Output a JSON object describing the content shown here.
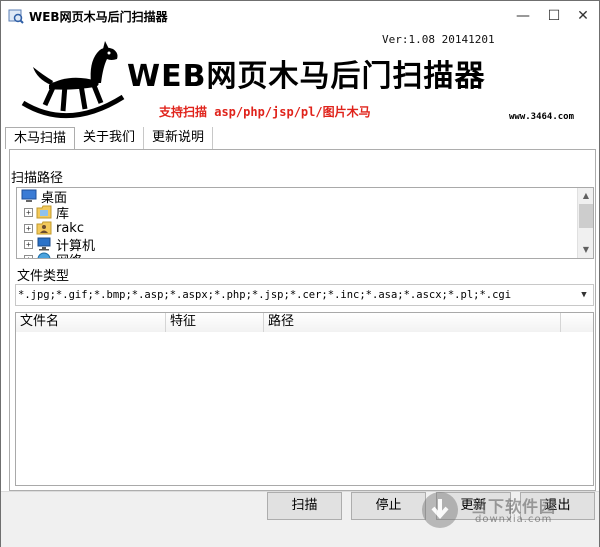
{
  "window": {
    "title": "WEB网页木马后门扫描器",
    "minimize": "—",
    "maximize": "☐",
    "close": "✕"
  },
  "banner": {
    "version": "Ver:1.08 20141201",
    "title": "WEB网页木马后门扫描器",
    "support": "支持扫描 asp/php/jsp/pl/图片木马",
    "site": "www.3464.com",
    "support_color": "#e0231b"
  },
  "tabs": [
    {
      "label": "木马扫描",
      "active": true
    },
    {
      "label": "关于我们",
      "active": false
    },
    {
      "label": "更新说明",
      "active": false
    }
  ],
  "scan_path": {
    "label": "扫描路径",
    "tree": [
      {
        "label": "桌面",
        "icon": "desktop-icon",
        "expander": ""
      },
      {
        "label": "库",
        "icon": "library-folder-icon",
        "expander": "+"
      },
      {
        "label": "rakc",
        "icon": "user-folder-icon",
        "expander": "+"
      },
      {
        "label": "计算机",
        "icon": "computer-icon",
        "expander": "+"
      },
      {
        "label": "网络",
        "icon": "network-icon",
        "expander": "+"
      }
    ]
  },
  "file_type": {
    "label": "文件类型",
    "value": "*.jpg;*.gif;*.bmp;*.asp;*.aspx;*.php;*.jsp;*.cer;*.inc;*.asa;*.ascx;*.pl;*.cgi"
  },
  "results": {
    "columns": [
      "文件名",
      "特征",
      "路径"
    ]
  },
  "buttons": {
    "scan": "扫描",
    "stop": "停止",
    "update": "更新",
    "exit": "退出"
  },
  "watermark": {
    "name": "当下软件园",
    "url": "downxia.com"
  }
}
